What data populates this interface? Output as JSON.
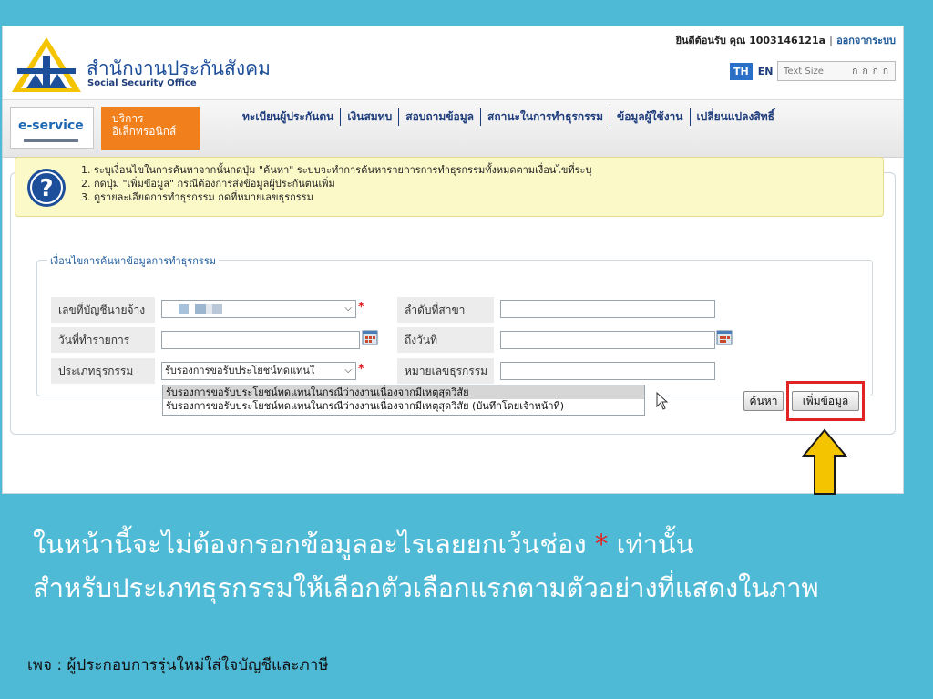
{
  "header": {
    "welcome": "ยินดีต้อนรับ คุณ 1003146121a",
    "logout": "ออกจากระบบ",
    "org_th": "สำนักงานประกันสังคม",
    "org_en": "Social Security Office",
    "lang_th": "TH",
    "lang_en": "EN",
    "text_size_label": "Text Size",
    "text_size_options": "ก ก ก ก"
  },
  "eservice": {
    "label": "e-service",
    "line1": "บริการ",
    "line2": "อิเล็กทรอนิกส์"
  },
  "menu": [
    "ทะเบียนผู้ประกันตน",
    "เงินสมทบ",
    "สอบถามข้อมูล",
    "สถานะในการทำธุรกรรม",
    "ข้อมูลผู้ใช้งาน",
    "เปลี่ยนแปลงสิทธิ์"
  ],
  "help": [
    "1. ระบุเงื่อนไขในการค้นหาจากนั้นกดปุ่ม \"ค้นหา\" ระบบจะทำการค้นหารายการการทำธุรกรรมทั้งหมดตามเงื่อนไขที่ระบุ",
    "2. กดปุ่ม \"เพิ่มข้อมูล\" กรณีต้องการส่งข้อมูลผู้ประกันตนเพิ่ม",
    "3. ดูรายละเอียดการทำธุรกรรม กดที่หมายเลขธุรกรรม"
  ],
  "search": {
    "legend": "เงื่อนไขการค้นหาข้อมูลการทำธุรกรรม",
    "employer_account_label": "เลขที่บัญชีนายจ้าง",
    "transaction_date_label": "วันที่ทำรายการ",
    "transaction_type_label": "ประเภทธุรกรรม",
    "transaction_type_value": "รับรองการขอรับประโยชน์ทดแทนใ",
    "branch_label": "ลำดับที่สาขา",
    "to_date_label": "ถึงวันที่",
    "transaction_no_label": "หมายเลขธุรกรรม",
    "required_mark": "*",
    "options": [
      "รับรองการขอรับประโยชน์ทดแทนในกรณีว่างงานเนื่องจากมีเหตุสุดวิสัย",
      "รับรองการขอรับประโยชน์ทดแทนในกรณีว่างงานเนื่องจากมีเหตุสุดวิสัย (บันทึกโดยเจ้าหน้าที่)"
    ],
    "search_button": "ค้นหา",
    "add_button": "เพิ่มข้อมูล"
  },
  "caption": {
    "line1_before": "ในหน้านี้จะไม่ต้องกรอกข้อมูลอะไรเลยยกเว้นช่อง",
    "star": "*",
    "line1_after": "เท่านั้น",
    "line2": "สำหรับประเภทธุรกรรมให้เลือกตัวเลือกแรกตามตัวอย่างที่แสดงในภาพ",
    "footer": "เพจ : ผู้ประกอบการรุ่นใหม่ใส่ใจบัญชีและภาษี"
  },
  "colors": {
    "background": "#4fbad6",
    "accent_orange": "#f07f1c",
    "highlight_red": "#e02424",
    "arrow_yellow": "#f5c400"
  }
}
